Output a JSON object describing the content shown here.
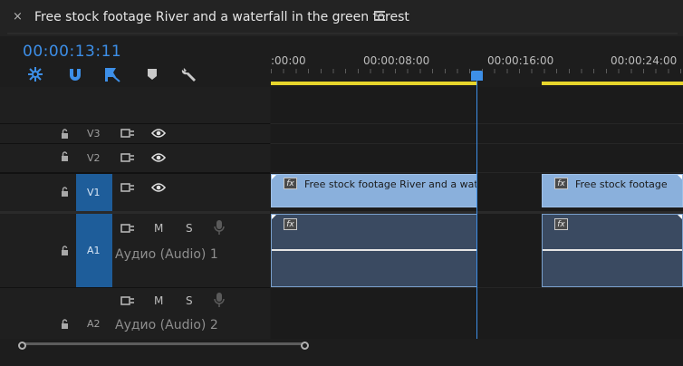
{
  "header": {
    "close_glyph": "×",
    "sequence_title": "Free stock footage River and a waterfall in the green forest",
    "menu_icon": "hamburger-icon"
  },
  "timecode": "00:00:13:11",
  "tools": [
    {
      "name": "snap-in-timeline-icon"
    },
    {
      "name": "magnet-linked-selection-icon"
    },
    {
      "name": "add-marker-flag-icon"
    },
    {
      "name": "marker-icon"
    },
    {
      "name": "wrench-settings-icon"
    }
  ],
  "ruler": {
    "labels": [
      ":00:00",
      "00:00:08:00",
      "00:00:16:00",
      "00:00:24:00"
    ]
  },
  "tracks": {
    "v3": {
      "name": "V3"
    },
    "v2": {
      "name": "V2"
    },
    "v1": {
      "name": "V1"
    },
    "a1": {
      "name": "A1",
      "m": "M",
      "s": "S",
      "label": "Аудио (Audio) 1"
    },
    "a2": {
      "name": "A2",
      "m": "M",
      "s": "S",
      "label": "Аудио (Audio) 2"
    }
  },
  "clips": {
    "video1": {
      "label": "Free stock footage River and a water",
      "fx": "fx"
    },
    "video2": {
      "label": "Free stock footage",
      "fx": "fx"
    },
    "audio1": {
      "fx": "fx"
    },
    "audio2": {
      "fx": "fx"
    }
  },
  "colors": {
    "accent_blue": "#3d8fe8",
    "work_area_bar": "#e7d52c",
    "video_clip": "#8ab0dc",
    "audio_clip": "#3a4a61",
    "selected_track": "#1e5d9a"
  }
}
